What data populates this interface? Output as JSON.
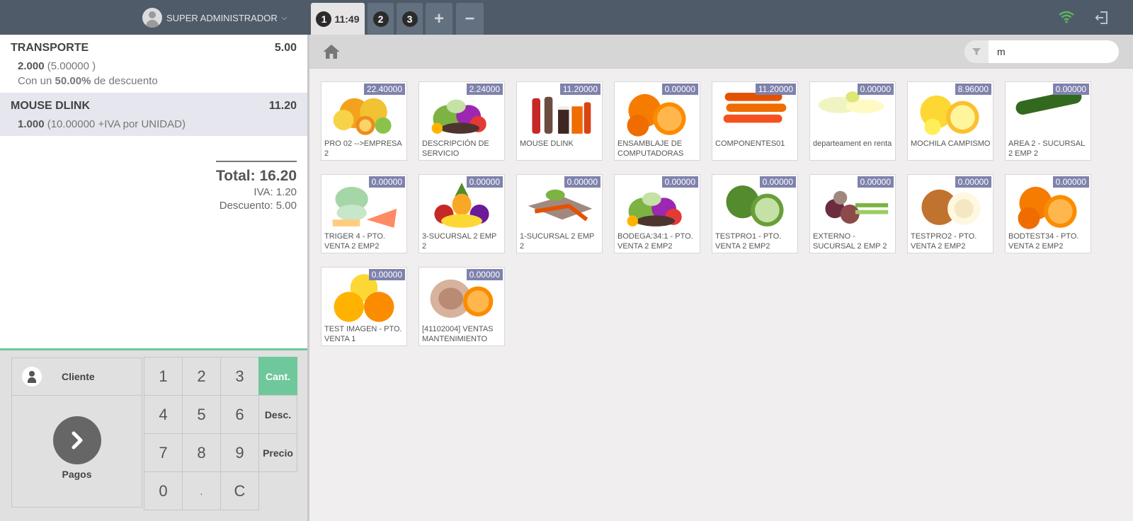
{
  "header": {
    "user_name": "SUPER ADMINISTRADOR",
    "orders": [
      {
        "number": "1",
        "time": "11:49"
      },
      {
        "number": "2"
      },
      {
        "number": "3"
      }
    ],
    "add_label": "+",
    "remove_label": "−",
    "icons": {
      "wifi": "wifi-icon",
      "logout": "logout-icon"
    },
    "wifi_color": "#5cb85c"
  },
  "order": {
    "lines": [
      {
        "name": "TRANSPORTE",
        "price": "5.00",
        "qty": "2.000",
        "unit": "(5.00000 )",
        "disc_pre": "Con un",
        "disc_pct": "50.00%",
        "disc_post": "de descuento"
      },
      {
        "name": "MOUSE DLINK",
        "price": "11.20",
        "qty": "1.000",
        "unit": "(10.00000 +IVA por UNIDAD)"
      }
    ],
    "total": "Total: 16.20",
    "iva": "IVA: 1.20",
    "discount": "Descuento: 5.00"
  },
  "pad": {
    "customer_label": "Cliente",
    "payment_label": "Pagos",
    "keys": [
      "1",
      "2",
      "3",
      "4",
      "5",
      "6",
      "7",
      "8",
      "9",
      "0",
      ".",
      "C"
    ],
    "modes": [
      "Cant.",
      "Desc.",
      "Precio"
    ],
    "active_mode": "Cant.",
    "accent": "#6ec89b"
  },
  "search": {
    "value": "m"
  },
  "products": [
    {
      "name": "PRO 02 -->EMPRESA 2",
      "price": "22.40000",
      "image": "citrus"
    },
    {
      "name": "DESCRIPCIÓN DE SERVICIO",
      "price": "2.24000",
      "image": "vegetables"
    },
    {
      "name": "MOUSE DLINK",
      "price": "11.20000",
      "image": "drinks"
    },
    {
      "name": "ENSAMBLAJE DE COMPUTADORAS",
      "price": "0.00000",
      "image": "oranges"
    },
    {
      "name": "COMPONENTES01",
      "price": "11.20000",
      "image": "carrots"
    },
    {
      "name": "departeament en renta",
      "price": "0.00000",
      "image": "endive"
    },
    {
      "name": "MOCHILA CAMPISMO",
      "price": "8.96000",
      "image": "lemons"
    },
    {
      "name": "AREA 2 - SUCURSAL 2 EMP 2",
      "price": "0.00000",
      "image": "zucchini"
    },
    {
      "name": "TRIGER 4 - PTO. VENTA 2 EMP2",
      "price": "0.00000",
      "image": "food"
    },
    {
      "name": "3-SUCURSAL 2 EMP 2",
      "price": "0.00000",
      "image": "fruits"
    },
    {
      "name": "1-SUCURSAL 2 EMP 2",
      "price": "0.00000",
      "image": "roots"
    },
    {
      "name": "BODEGA:34:1 - PTO. VENTA 2 EMP2",
      "price": "0.00000",
      "image": "vegetables"
    },
    {
      "name": "TESTPRO1 - PTO. VENTA 2 EMP2",
      "price": "0.00000",
      "image": "limes"
    },
    {
      "name": "EXTERNO - SUCURSAL 2 EMP 2",
      "price": "0.00000",
      "image": "onions"
    },
    {
      "name": "TESTPRO2 - PTO. VENTA 2 EMP2",
      "price": "0.00000",
      "image": "onion-brown"
    },
    {
      "name": "BODTEST34 - PTO. VENTA 2 EMP2",
      "price": "0.00000",
      "image": "oranges"
    },
    {
      "name": "TEST IMAGEN - PTO. VENTA 1",
      "price": "0.00000",
      "image": "grapefruit"
    },
    {
      "name": "[41102004] VENTAS MANTENIMIENTO",
      "price": "0.00000",
      "image": "cheese-orange"
    }
  ],
  "colors": {
    "topbar": "#4f5b69",
    "price_badge": "#7f82ac"
  }
}
